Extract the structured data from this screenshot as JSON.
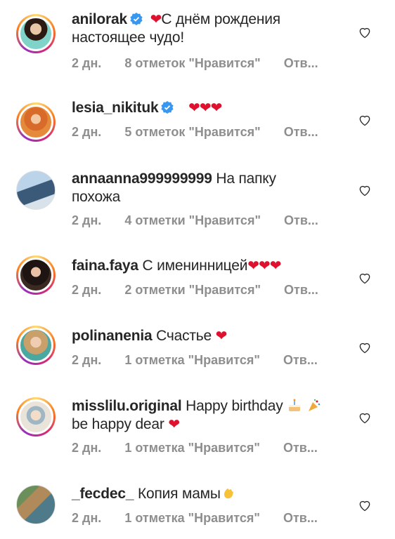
{
  "comments": [
    {
      "username": "anilorak",
      "verified": true,
      "text_before_heart": "",
      "text": "С днём рождения настоящее чудо!",
      "leading_hearts": "❤",
      "trailing_hearts": "",
      "time": "2 дн.",
      "likes": "8 отметок \"Нравится\"",
      "reply": "Отв..."
    },
    {
      "username": "lesia_nikituk",
      "verified": true,
      "text": "",
      "leading_hearts": "❤❤❤",
      "trailing_hearts": "",
      "time": "2 дн.",
      "likes": "5 отметок \"Нравится\"",
      "reply": "Отв..."
    },
    {
      "username": "annaanna999999999",
      "verified": false,
      "text": "На папку похожа",
      "leading_hearts": "",
      "trailing_hearts": "",
      "time": "2 дн.",
      "likes": "4 отметки \"Нравится\"",
      "reply": "Отв..."
    },
    {
      "username": "faina.faya",
      "verified": false,
      "text": "С именинницей",
      "leading_hearts": "",
      "trailing_hearts": "❤❤❤",
      "time": "2 дн.",
      "likes": "2 отметки \"Нравится\"",
      "reply": "Отв..."
    },
    {
      "username": "polinanenia",
      "verified": false,
      "text": "Счастье",
      "leading_hearts": "",
      "trailing_hearts": "❤",
      "time": "2 дн.",
      "likes": "1 отметка \"Нравится\"",
      "reply": "Отв..."
    },
    {
      "username": "misslilu.original",
      "verified": false,
      "text": "Happy birthday",
      "text_line2": "be happy dear",
      "leading_hearts": "",
      "trailing_hearts": "❤",
      "time": "2 дн.",
      "likes": "1 отметка \"Нравится\"",
      "reply": "Отв..."
    },
    {
      "username": "_fecdec_",
      "verified": false,
      "text": "Копия мамы",
      "leading_hearts": "",
      "trailing_hearts": "",
      "time": "2 дн.",
      "likes": "1 отметка \"Нравится\"",
      "reply": "Отв..."
    }
  ],
  "icons": {
    "like": "heart-outline-icon",
    "verified": "verified-badge-icon"
  },
  "colors": {
    "text": "#262626",
    "meta": "#8e8e8e",
    "heart": "#e0102f",
    "verified": "#3897f0"
  }
}
